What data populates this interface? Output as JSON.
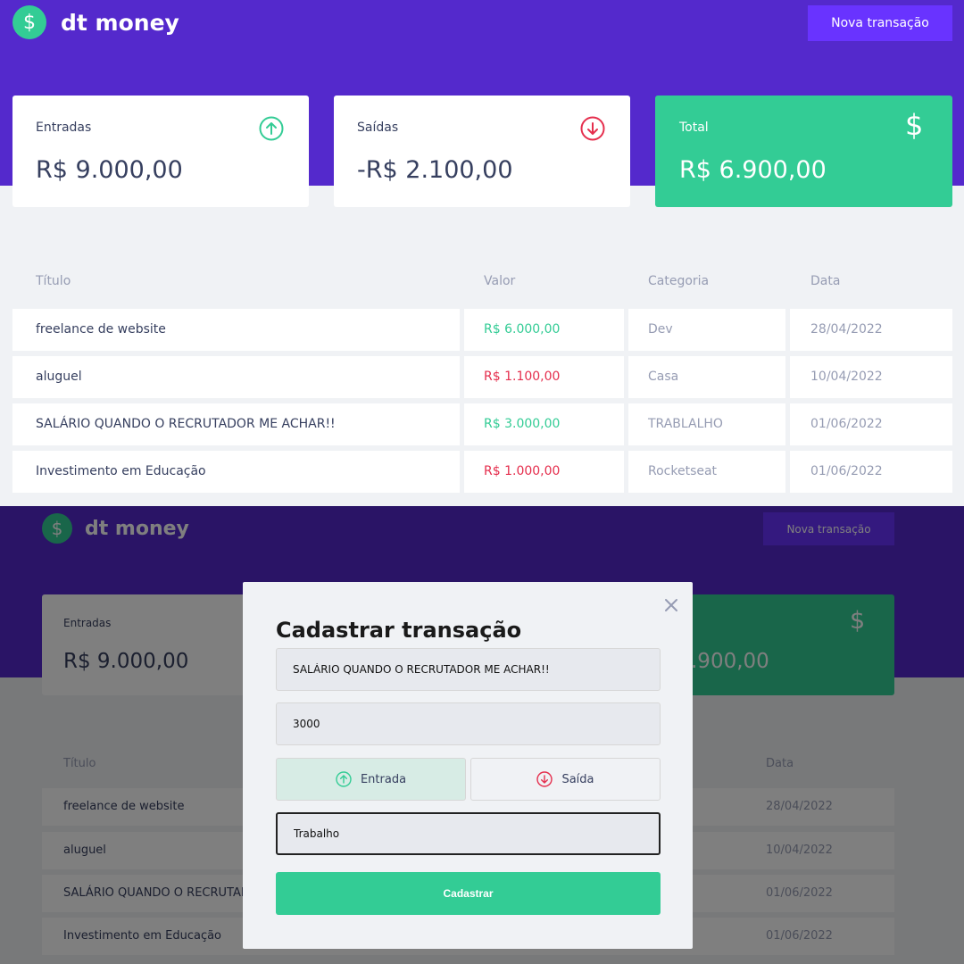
{
  "app": {
    "brand": "dt money",
    "logo_symbol": "$",
    "new_transaction_label": "Nova transação"
  },
  "summary": {
    "income": {
      "label": "Entradas",
      "value": "R$ 9.000,00",
      "icon": "arrow-up-circle-icon"
    },
    "outcome": {
      "label": "Saídas",
      "value": "-R$ 2.100,00",
      "icon": "arrow-down-circle-icon"
    },
    "total": {
      "label": "Total",
      "value": "R$ 6.900,00",
      "value_partial": ".900,00",
      "icon": "dollar-icon"
    }
  },
  "table": {
    "headers": [
      "Título",
      "Valor",
      "Categoria",
      "Data"
    ],
    "rows": [
      {
        "title": "freelance de website",
        "amount": "R$ 6.000,00",
        "type": "deposit",
        "category": "Dev",
        "date": "28/04/2022"
      },
      {
        "title": "aluguel",
        "amount": "R$ 1.100,00",
        "type": "withdraw",
        "category": "Casa",
        "date": "10/04/2022"
      },
      {
        "title": "SALÁRIO QUANDO O RECRUTADOR ME ACHAR!!",
        "title_partial": "SALÁRIO QUANDO O RECRUTADOR",
        "amount": "R$ 3.000,00",
        "type": "deposit",
        "category": "TRABLALHO",
        "date": "01/06/2022"
      },
      {
        "title": "Investimento em Educação",
        "amount": "R$ 1.000,00",
        "type": "withdraw",
        "category": "Rocketseat",
        "date": "01/06/2022"
      }
    ]
  },
  "modal": {
    "title": "Cadastrar transação",
    "title_value": "SALÁRIO QUANDO O RECRUTADOR ME ACHAR!!",
    "amount_value": "3000",
    "deposit_label": "Entrada",
    "withdraw_label": "Saída",
    "category_value": "Trabalho",
    "submit_label": "Cadastrar"
  },
  "colors": {
    "brand_purple": "#5429cc",
    "button_purple": "#6933ff",
    "green": "#33cc95",
    "red": "#e52e4d",
    "text": "#363f5f",
    "muted": "#969cb3",
    "background": "#f0f2f5"
  }
}
